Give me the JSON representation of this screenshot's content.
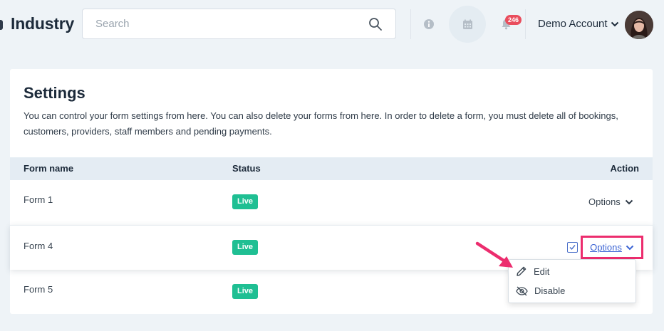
{
  "header": {
    "app_title": "Industry",
    "search_placeholder": "Search",
    "notification_count": "246",
    "account_name": "Demo Account"
  },
  "settings": {
    "title": "Settings",
    "description": "You can control your form settings from here. You can also delete your forms from here. In order to delete a form, you must delete all of bookings, customers, providers, staff members and pending payments."
  },
  "table": {
    "columns": [
      "Form name",
      "Status",
      "Action"
    ],
    "rows": [
      {
        "name": "Form 1",
        "status": "Live",
        "action": "Options"
      },
      {
        "name": "Form 4",
        "status": "Live",
        "action": "Options"
      },
      {
        "name": "Form 5",
        "status": "Live",
        "action": ""
      }
    ]
  },
  "dropdown": {
    "items": [
      {
        "label": "Edit",
        "icon": "pencil-icon"
      },
      {
        "label": "Disable",
        "icon": "eye-slash-icon"
      }
    ]
  },
  "colors": {
    "live_badge": "#1fbf93",
    "highlight": "#ec2d6e",
    "notification_badge": "#e94d5d",
    "link": "#3a63d4"
  }
}
